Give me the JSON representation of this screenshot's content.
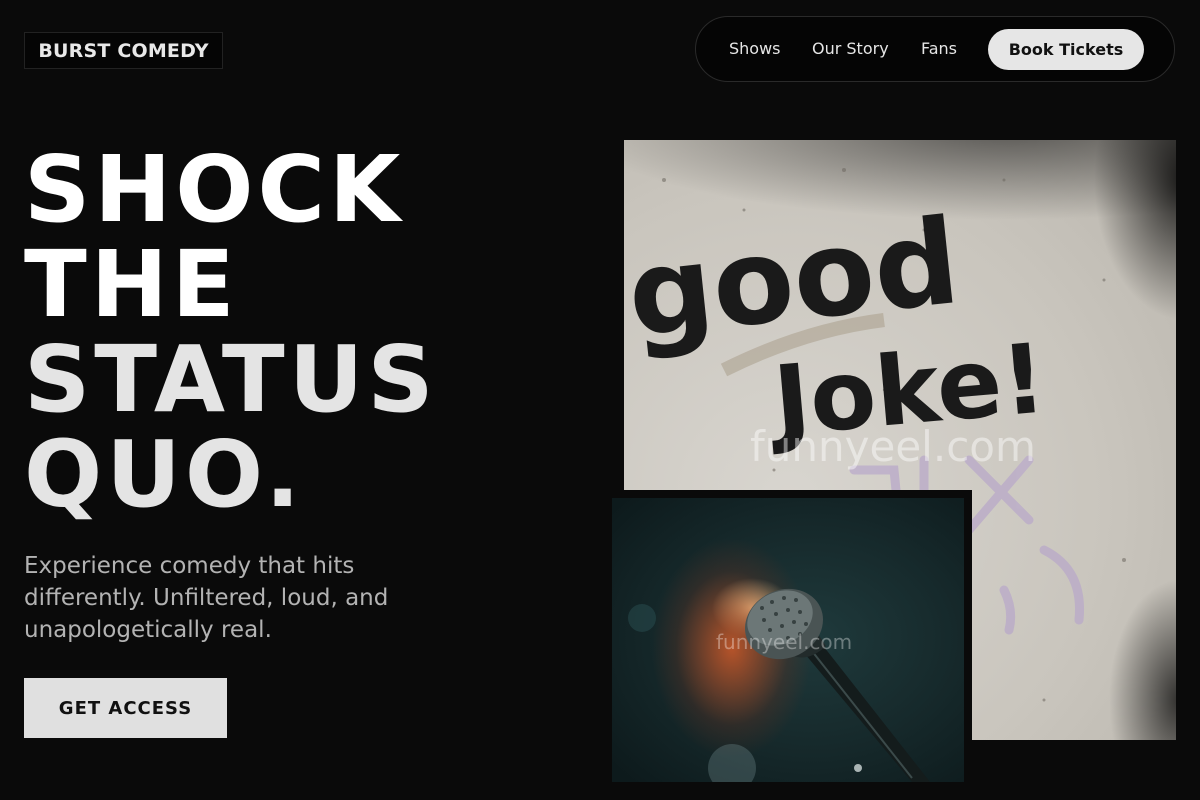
{
  "brand": {
    "name": "BURST COMEDY"
  },
  "nav": {
    "links": [
      "Shows",
      "Our Story",
      "Fans"
    ],
    "cta_label": "Book Tickets"
  },
  "hero": {
    "headline_lines": [
      "SHOCK",
      "THE",
      "STATUS",
      "QUO."
    ],
    "subtitle": "Experience comedy that hits differently. Unfiltered, loud, and unapologetically real.",
    "cta_label": "GET ACCESS"
  },
  "images": {
    "wall": {
      "graffiti_line1": "good",
      "graffiti_line2": "Joke!",
      "watermark": "funnyeel.com"
    },
    "mic": {
      "watermark": "funnyeel.com"
    }
  },
  "colors": {
    "background": "#0a0a0a",
    "accent_button": "#e6e6e6",
    "text_primary": "#ffffff",
    "text_muted": "#b3b3b3"
  }
}
